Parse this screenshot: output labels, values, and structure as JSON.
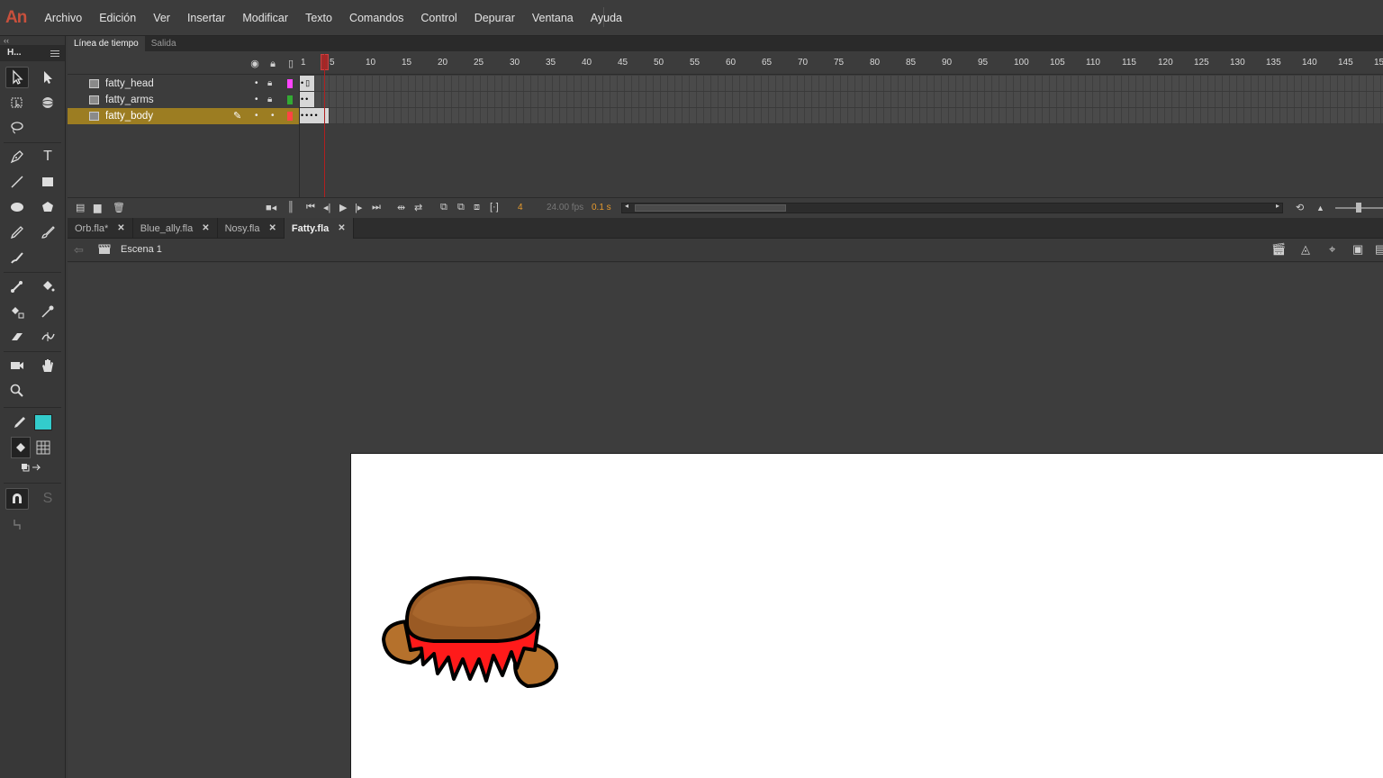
{
  "app": {
    "logo": "An",
    "menu": [
      "Archivo",
      "Edición",
      "Ver",
      "Insertar",
      "Modificar",
      "Texto",
      "Comandos",
      "Control",
      "Depurar",
      "Ventana",
      "Ayuda"
    ]
  },
  "toolbar": {
    "collapse": "‹‹",
    "title": "H...",
    "fill_color": "#33cccc"
  },
  "timeline": {
    "tabs": [
      "Línea de tiempo",
      "Salida"
    ],
    "ruler": [
      "1",
      "5",
      "10",
      "15",
      "20",
      "25",
      "30",
      "35",
      "40",
      "45",
      "50",
      "55",
      "60",
      "65",
      "70",
      "75",
      "80",
      "85",
      "90",
      "95",
      "100",
      "105",
      "110",
      "115",
      "120",
      "125",
      "130",
      "135",
      "140",
      "145",
      "15"
    ],
    "layers": [
      {
        "name": "fatty_head",
        "color": "#ff44ff",
        "keyframes": "•▯"
      },
      {
        "name": "fatty_arms",
        "color": "#33aa33",
        "keyframes": "••"
      },
      {
        "name": "fatty_body",
        "color": "#ff4444",
        "keyframes": "••••"
      }
    ],
    "current_frame": "4",
    "fps": "24.00 fps",
    "time": "0.1 s"
  },
  "documents": {
    "tabs": [
      "Orb.fla*",
      "Blue_ally.fla",
      "Nosy.fla",
      "Fatty.fla"
    ],
    "active": "Fatty.fla"
  },
  "editbar": {
    "scene": "Escena 1"
  }
}
